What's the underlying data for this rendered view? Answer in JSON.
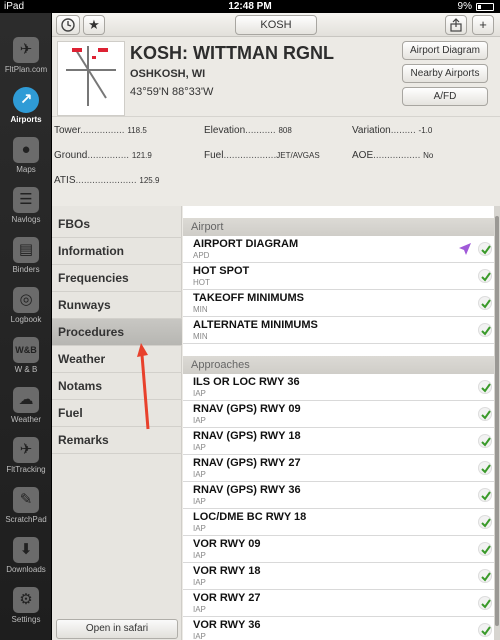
{
  "status": {
    "device": "iPad",
    "time": "12:48 PM",
    "battery": "9%"
  },
  "toolbar": {
    "airport_code": "KOSH",
    "plus": "+"
  },
  "sidebar": {
    "tabs": [
      {
        "label": "FltPlan.com",
        "glyph": "✈"
      },
      {
        "label": "Airports",
        "glyph": "↗"
      },
      {
        "label": "Maps",
        "glyph": "●"
      },
      {
        "label": "Navlogs",
        "glyph": "☰"
      },
      {
        "label": "Binders",
        "glyph": "▤"
      },
      {
        "label": "Logbook",
        "glyph": "◎"
      },
      {
        "label": "W & B",
        "glyph": "W&B"
      },
      {
        "label": "Weather",
        "glyph": "☁"
      },
      {
        "label": "FltTracking",
        "glyph": "✈"
      },
      {
        "label": "ScratchPad",
        "glyph": "✎"
      },
      {
        "label": "Downloads",
        "glyph": "⬇"
      },
      {
        "label": "Settings",
        "glyph": "⚙"
      }
    ]
  },
  "airport": {
    "title": "KOSH: WITTMAN RGNL",
    "city": "OSHKOSH, WI",
    "coords": "43°59'N  88°33'W"
  },
  "buttons": {
    "diagram": "Airport Diagram",
    "nearby": "Nearby Airports",
    "afd": "A/FD"
  },
  "info": {
    "tower_label": "Tower",
    "tower_dots": "................",
    "tower": "118.5",
    "ground_label": "Ground",
    "ground_dots": "...............",
    "ground": "121.9",
    "atis_label": "ATIS",
    "atis_dots": "......................",
    "atis": "125.9",
    "elev_label": "Elevation",
    "elev_dots": "...........",
    "elev": "808",
    "fuel_label": "Fuel",
    "fuel_dots": "...................",
    "fuel": "JET/AVGAS",
    "var_label": "Variation",
    "var_dots": ".........",
    "var": "-1.0",
    "aoe_label": "AOE",
    "aoe_dots": ".................",
    "aoe": "No"
  },
  "menu": {
    "items": [
      "FBOs",
      "Information",
      "Frequencies",
      "Runways",
      "Procedures",
      "Weather",
      "Notams",
      "Fuel",
      "Remarks"
    ],
    "selected": "Procedures",
    "safari": "Open in safari"
  },
  "procedures": {
    "airport_header": "Airport",
    "airport_items": [
      {
        "name": "AIRPORT DIAGRAM",
        "sub": "APD"
      },
      {
        "name": "HOT SPOT",
        "sub": "HOT"
      },
      {
        "name": "TAKEOFF MINIMUMS",
        "sub": "MIN"
      },
      {
        "name": "ALTERNATE MINIMUMS",
        "sub": "MIN"
      }
    ],
    "approaches_header": "Approaches",
    "approach_items": [
      {
        "name": "ILS OR LOC RWY 36",
        "sub": "IAP"
      },
      {
        "name": "RNAV (GPS) RWY 09",
        "sub": "IAP"
      },
      {
        "name": "RNAV (GPS) RWY 18",
        "sub": "IAP"
      },
      {
        "name": "RNAV (GPS) RWY 27",
        "sub": "IAP"
      },
      {
        "name": "RNAV (GPS) RWY 36",
        "sub": "IAP"
      },
      {
        "name": "LOC/DME BC RWY 18",
        "sub": "IAP"
      },
      {
        "name": "VOR RWY 09",
        "sub": "IAP"
      },
      {
        "name": "VOR RWY 18",
        "sub": "IAP"
      },
      {
        "name": "VOR RWY 27",
        "sub": "IAP"
      },
      {
        "name": "VOR RWY 36",
        "sub": "IAP"
      }
    ]
  },
  "colors": {
    "accent": "#2f9bd6",
    "check": "#3a9a2a",
    "arrow": "#e8412c",
    "location": "#a05ad8"
  }
}
